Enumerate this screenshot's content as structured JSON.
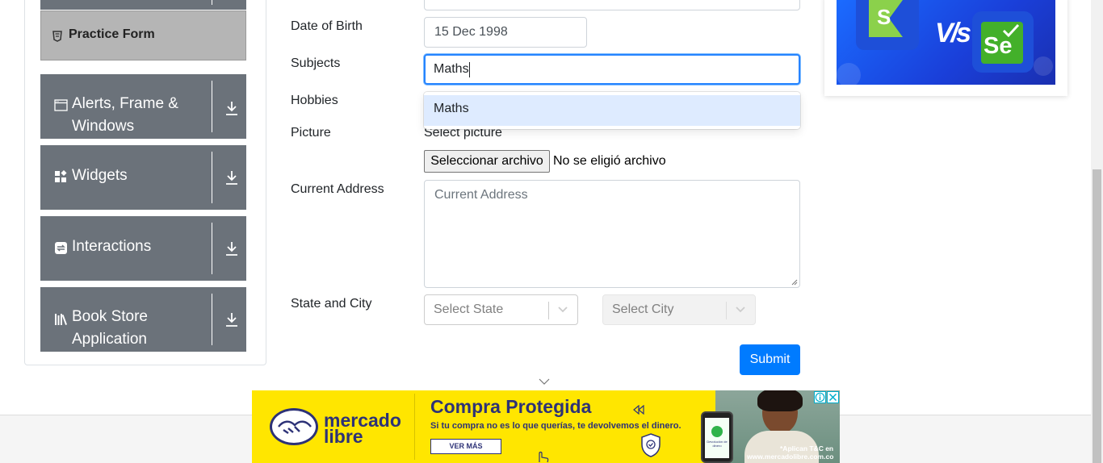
{
  "sidebar": {
    "practice_form": "Practice Form",
    "groups": [
      {
        "label_line1": "Alerts, Frame &",
        "label_line2": "Windows",
        "icon": "window-icon"
      },
      {
        "label_line1": "Widgets",
        "label_line2": "",
        "icon": "widgets-icon"
      },
      {
        "label_line1": "Interactions",
        "label_line2": "",
        "icon": "interactions-icon"
      },
      {
        "label_line1": "Book Store",
        "label_line2": "Application",
        "icon": "bookstore-icon"
      }
    ]
  },
  "form": {
    "dob_label": "Date of Birth",
    "dob_value": "15 Dec 1998",
    "subjects_label": "Subjects",
    "subjects_value": "Maths",
    "subjects_option": "Maths",
    "hobbies_label": "Hobbies",
    "picture_label": "Picture",
    "select_picture": "Select picture",
    "file_button": "Seleccionar archivo",
    "file_status": "No se eligió archivo",
    "address_label": "Current Address",
    "address_placeholder": "Current Address",
    "state_city_label": "State and City",
    "state_placeholder": "Select State",
    "city_placeholder": "Select City",
    "submit": "Submit"
  },
  "right_ad": {
    "vs_text": "V/s",
    "se_text": "Se",
    "s_text": "S"
  },
  "bottom_ad": {
    "brand_line1": "mercado",
    "brand_line2": "libre",
    "headline": "Compra Protegida",
    "subtext": "Si tu compra no es lo que querías, te devolvemos el dinero.",
    "cta": "VER MÁS",
    "legal_line1": "*Aplican T&C en",
    "legal_line2": "www.mercadolibre.com.co",
    "phone_text": "Devolución de dinero",
    "colors": {
      "bg": "#ffe600",
      "brand_blue": "#2d3277"
    }
  }
}
